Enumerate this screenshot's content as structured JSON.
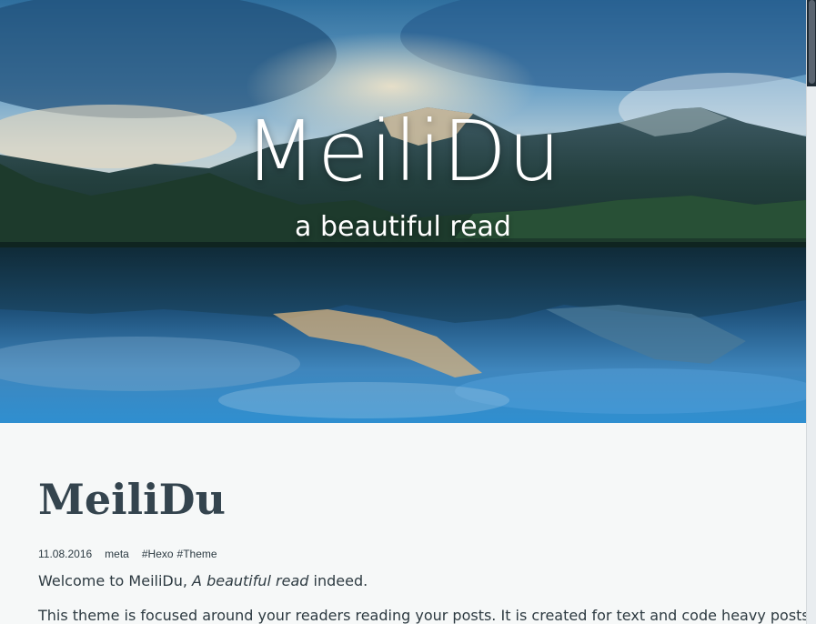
{
  "hero": {
    "title": "MeiliDu",
    "subtitle": "a beautiful read",
    "image": "mountain-lake-landscape"
  },
  "post": {
    "title": "MeiliDu",
    "date": "11.08.2016",
    "category": "meta",
    "tags": [
      "#Hexo",
      "#Theme"
    ],
    "intro_prefix": "Welcome to MeiliDu, ",
    "intro_emphasis": "A beautiful read",
    "intro_suffix": " indeed.",
    "body_line": "This theme is focused around your readers reading your posts. It is created for text and code heavy posts,"
  },
  "colors": {
    "page_bg": "#f6f8f8",
    "title_color": "#34444e",
    "text_color": "#2d3a41",
    "hero_text": "#ffffff"
  }
}
